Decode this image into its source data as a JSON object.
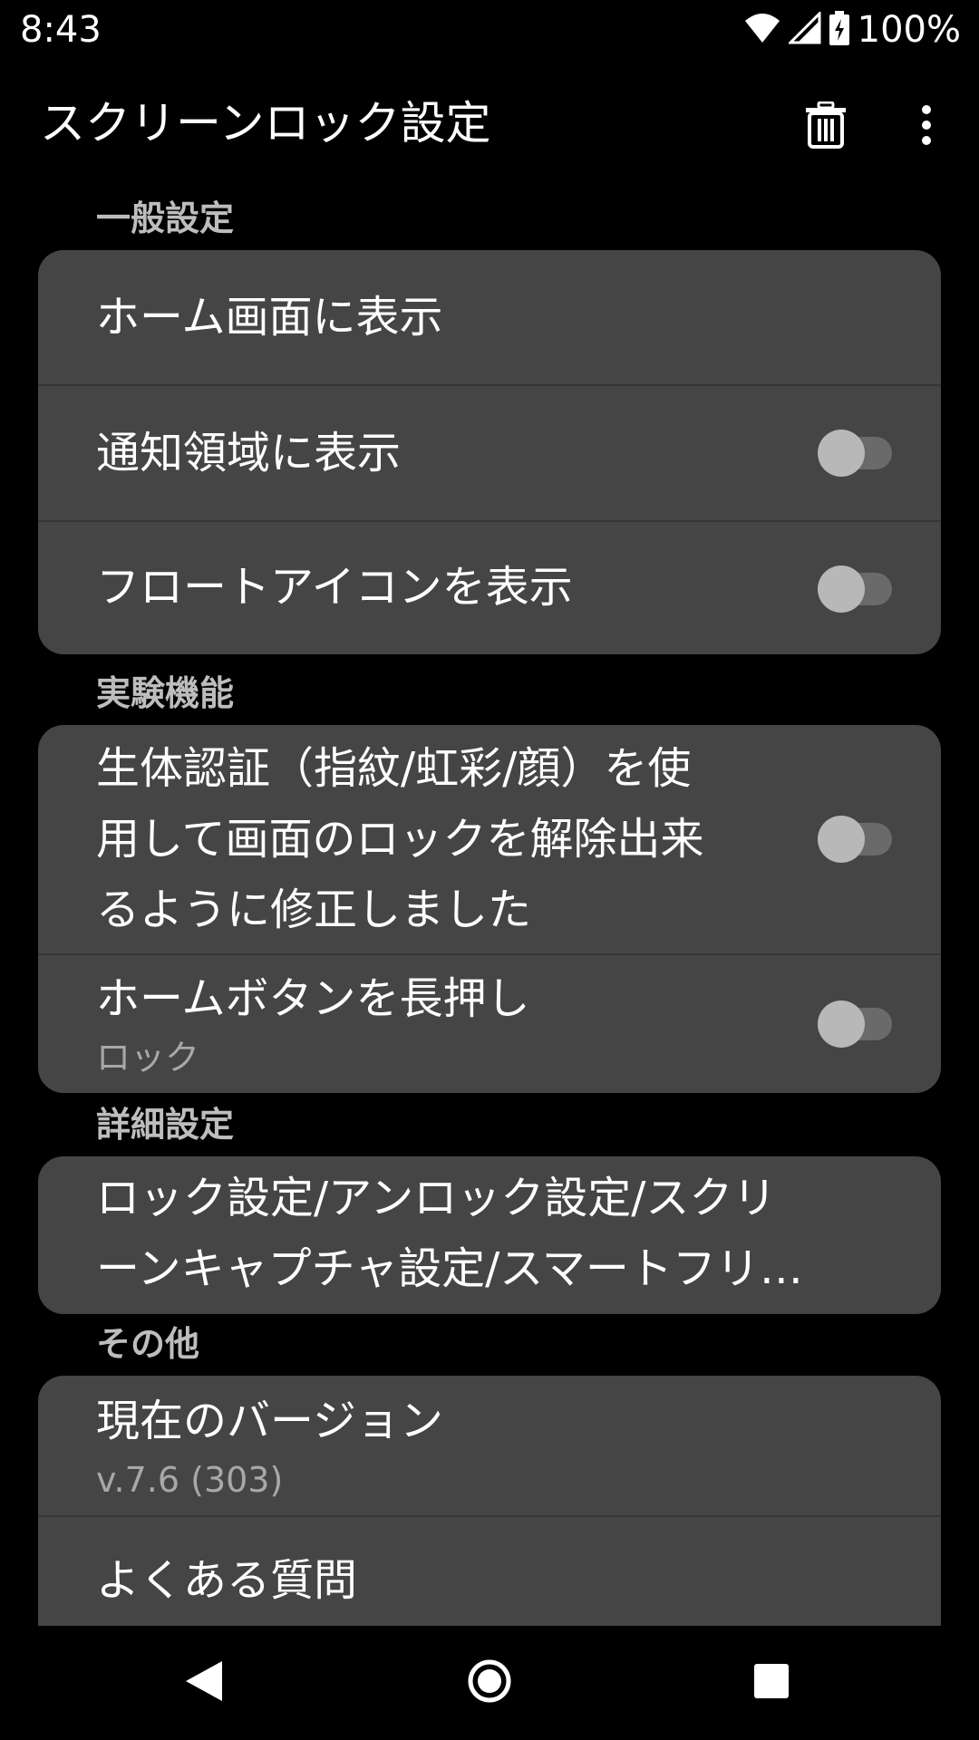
{
  "status_bar": {
    "time": "8:43",
    "battery": "100%"
  },
  "app_bar": {
    "title": "スクリーンロック設定",
    "delete_icon": "trash-icon",
    "more_icon": "more-vert-icon"
  },
  "sections": {
    "general": {
      "header": "一般設定",
      "items": {
        "home": {
          "title": "ホーム画面に表示"
        },
        "notification": {
          "title": "通知領域に表示",
          "enabled": false
        },
        "float_icon": {
          "title": "フロートアイコンを表示",
          "enabled": false
        }
      }
    },
    "experimental": {
      "header": "実験機能",
      "items": {
        "biometric": {
          "line1": "生体認証（指紋/虹彩/顔）を使",
          "line2": "用して画面のロックを解除出来",
          "line3": "るように修正しました",
          "enabled": false
        },
        "home_long_press": {
          "title": "ホームボタンを長押し",
          "summary": "ロック",
          "enabled": false
        }
      }
    },
    "advanced": {
      "header": "詳細設定",
      "items": {
        "lock_settings": {
          "line1": "ロック設定/アンロック設定/スクリ",
          "line2": "ーンキャプチャ設定/スマートフリ…"
        }
      }
    },
    "other": {
      "header": "その他",
      "items": {
        "version": {
          "title": "現在のバージョン",
          "summary": "v.7.6 (303)"
        },
        "faq": {
          "title": "よくある質問"
        }
      }
    }
  },
  "colors": {
    "background": "#000000",
    "card": "#454545",
    "divider": "#363636",
    "section_header": "#bdbdbd",
    "summary_text": "#a8a8a8",
    "switch_track": "#6a6a6a",
    "switch_thumb": "#b8b8b8"
  },
  "nav_bar": {
    "back_icon": "back-triangle-icon",
    "home_icon": "home-circle-icon",
    "recents_icon": "recents-square-icon"
  }
}
